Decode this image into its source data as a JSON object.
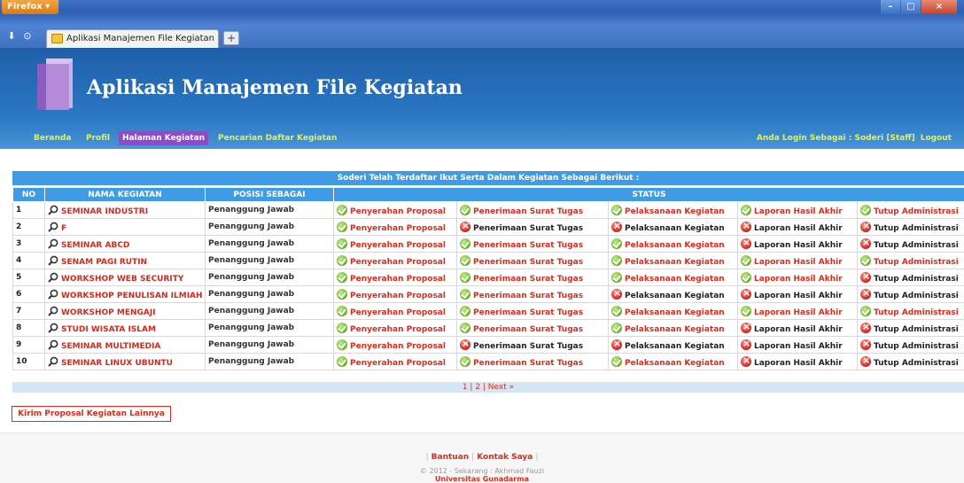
{
  "browser": {
    "firefox_label": "Firefox",
    "tab_title": "Aplikasi Manajemen File Kegiatan",
    "new_tab": "+"
  },
  "header": {
    "app_title": "Aplikasi Manajemen File Kegiatan",
    "menu": [
      "Beranda",
      "Profil",
      "Halaman Kegiatan",
      "Pencarian Daftar Kegiatan"
    ],
    "active_menu": "Halaman Kegiatan",
    "login_text": "Anda Login Sebagai : Soderi [Staff]",
    "logout": "Logout"
  },
  "table": {
    "caption": "Soderi Telah Terdaftar Ikut Serta Dalam Kegiatan Sebagai Berikut :",
    "headers": {
      "no": "NO",
      "name": "NAMA KEGIATAN",
      "position": "POSISI SEBAGAI",
      "status": "STATUS"
    },
    "status_labels": [
      "Penyerahan Proposal",
      "Penerimaan Surat Tugas",
      "Pelaksanaan Kegiatan",
      "Laporan Hasil Akhir",
      "Tutup Administrasi"
    ],
    "rows": [
      {
        "no": "1",
        "name": "SEMINAR INDUSTRI",
        "position": "Penanggung Jawab",
        "status": [
          "ok",
          "ok",
          "ok",
          "ok",
          "ok"
        ]
      },
      {
        "no": "2",
        "name": "F",
        "position": "Penanggung Jawab",
        "status": [
          "ok",
          "no",
          "no",
          "no",
          "no"
        ]
      },
      {
        "no": "3",
        "name": "SEMINAR ABCD",
        "position": "Penanggung Jawab",
        "status": [
          "ok",
          "ok",
          "ok",
          "no",
          "no"
        ]
      },
      {
        "no": "4",
        "name": "SENAM PAGI RUTIN",
        "position": "Penanggung Jawab",
        "status": [
          "ok",
          "ok",
          "ok",
          "ok",
          "ok"
        ]
      },
      {
        "no": "5",
        "name": "WORKSHOP WEB SECURITY",
        "position": "Penanggung Jawab",
        "status": [
          "ok",
          "ok",
          "ok",
          "ok",
          "no"
        ]
      },
      {
        "no": "6",
        "name": "WORKSHOP PENULISAN ILMIAH",
        "position": "Penanggung Jawab",
        "status": [
          "ok",
          "ok",
          "no",
          "no",
          "no"
        ]
      },
      {
        "no": "7",
        "name": "WORKSHOP MENGAJI",
        "position": "Penanggung Jawab",
        "status": [
          "ok",
          "ok",
          "ok",
          "ok",
          "ok"
        ]
      },
      {
        "no": "8",
        "name": "STUDI WISATA ISLAM",
        "position": "Penanggung Jawab",
        "status": [
          "ok",
          "ok",
          "ok",
          "no",
          "no"
        ]
      },
      {
        "no": "9",
        "name": "SEMINAR MULTIMEDIA",
        "position": "Penanggung Jawab",
        "status": [
          "ok",
          "no",
          "no",
          "no",
          "no"
        ]
      },
      {
        "no": "10",
        "name": "SEMINAR LINUX UBUNTU",
        "position": "Penanggung Jawab",
        "status": [
          "ok",
          "ok",
          "ok",
          "no",
          "no"
        ]
      }
    ],
    "pager": "1 | 2 | Next »"
  },
  "actions": {
    "kirim": "Kirim Proposal Kegiatan Lainnya"
  },
  "footer": {
    "links": [
      "Bantuan",
      "Kontak Saya"
    ],
    "copyright": "© 2012 - Sekarang : Akhmad Fauzi",
    "university": "Universitas Gunadarma"
  },
  "colors": {
    "header_blue": "#2b78c4",
    "menu_active": "#8a4dc6",
    "link_red": "#e02b1c",
    "table_head": "#3f9be6"
  }
}
